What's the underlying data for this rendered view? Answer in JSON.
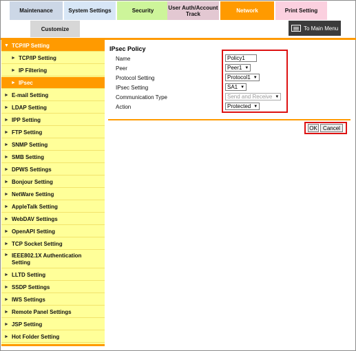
{
  "tabs": {
    "maintenance": "Maintenance",
    "system_settings": "System Settings",
    "security": "Security",
    "user_auth": "User Auth/Account Track",
    "network": "Network",
    "print_setting": "Print Setting",
    "customize": "Customize"
  },
  "main_menu": {
    "label": "To Main Menu"
  },
  "sidebar": {
    "items": [
      {
        "label": "TCP/IP Setting"
      },
      {
        "label": "TCP/IP Setting"
      },
      {
        "label": "IP Filtering"
      },
      {
        "label": "IPsec"
      },
      {
        "label": "E-mail Setting"
      },
      {
        "label": "LDAP Setting"
      },
      {
        "label": "IPP Setting"
      },
      {
        "label": "FTP Setting"
      },
      {
        "label": "SNMP Setting"
      },
      {
        "label": "SMB Setting"
      },
      {
        "label": "DPWS Settings"
      },
      {
        "label": "Bonjour Setting"
      },
      {
        "label": "NetWare Setting"
      },
      {
        "label": "AppleTalk Setting"
      },
      {
        "label": "WebDAV Settings"
      },
      {
        "label": "OpenAPI Setting"
      },
      {
        "label": "TCP Socket Setting"
      },
      {
        "label": "IEEE802.1X Authentication Setting"
      },
      {
        "label": "LLTD Setting"
      },
      {
        "label": "SSDP Settings"
      },
      {
        "label": "IWS Settings"
      },
      {
        "label": "Remote Panel Settings"
      },
      {
        "label": "JSP Setting"
      },
      {
        "label": "Hot Folder Setting"
      }
    ]
  },
  "content": {
    "title": "IPsec Policy",
    "fields": {
      "name": {
        "label": "Name",
        "value": "Policy1"
      },
      "peer": {
        "label": "Peer",
        "value": "Peer1"
      },
      "protocol": {
        "label": "Protocol Setting",
        "value": "Protocol1"
      },
      "ipsec": {
        "label": "IPsec Setting",
        "value": "SA1"
      },
      "comm_type": {
        "label": "Communication Type",
        "value": "Send and Receive"
      },
      "action": {
        "label": "Action",
        "value": "Protected"
      }
    },
    "ok_label": "OK",
    "cancel_label": "Cancel"
  }
}
